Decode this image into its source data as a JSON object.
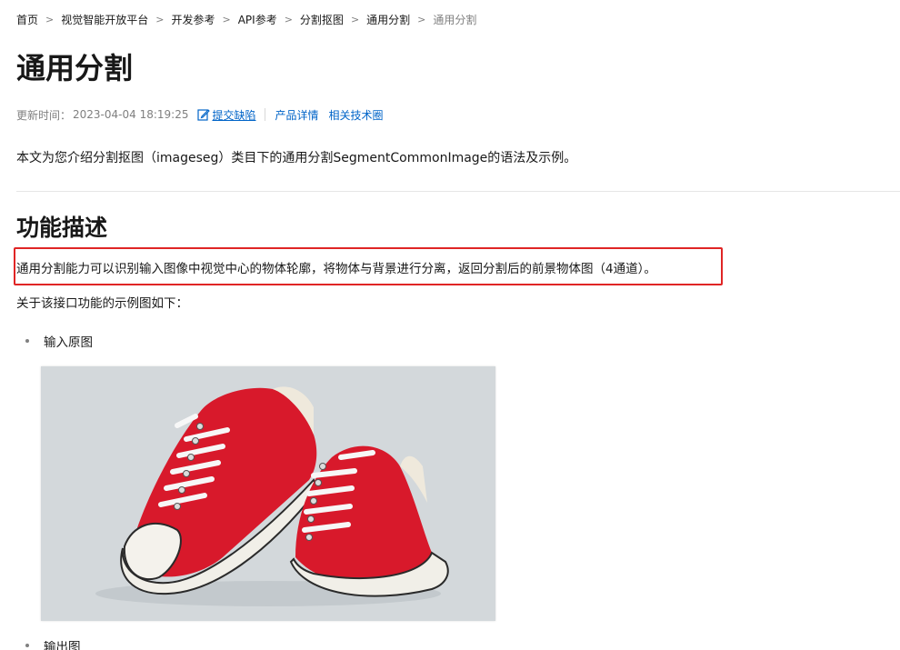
{
  "breadcrumb": {
    "items": [
      "首页",
      "视觉智能开放平台",
      "开发参考",
      "API参考",
      "分割抠图",
      "通用分割"
    ],
    "current": "通用分割"
  },
  "page": {
    "title": "通用分割",
    "meta": {
      "updated_label": "更新时间：",
      "updated_time": "2023-04-04 18:19:25",
      "report_bug": "提交缺陷",
      "product_details": "产品详情",
      "related_circle": "相关技术圈"
    },
    "intro": "本文为您介绍分割抠图（imageseg）类目下的通用分割SegmentCommonImage的语法及示例。",
    "section": {
      "heading": "功能描述",
      "description": "通用分割能力可以识别输入图像中视觉中心的物体轮廓，将物体与背景进行分离，返回分割后的前景物体图（4通道）。",
      "example_intro": "关于该接口功能的示例图如下：",
      "list": [
        "输入原图",
        "输出图"
      ]
    }
  },
  "colors": {
    "link": "#0064c8",
    "highlight_border": "#e02525",
    "image_background": "#d3d8db",
    "shoe_red": "#d8192b"
  }
}
